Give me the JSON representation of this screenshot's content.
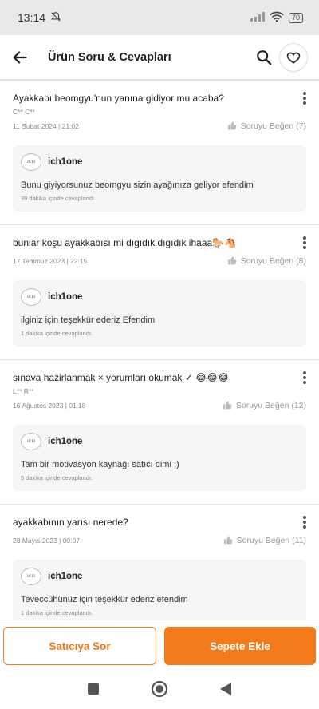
{
  "status": {
    "time": "13:14",
    "battery": "70"
  },
  "header": {
    "title": "Ürün Soru & Cevapları"
  },
  "questions": [
    {
      "text": "Ayakkabı beomgyu'nun yanına gidiyor mu acaba?",
      "author": "C** C**",
      "date": "11 Şubat 2024 | 21:02",
      "like": "Soruyu Beğen (7)",
      "seller": "ich1one",
      "answer": "Bunu giyiyorsunuz beomgyu sizin ayağınıza geliyor efendim",
      "answer_time": "39 dakika içinde cevaplandı."
    },
    {
      "text": "bunlar koşu ayakkabısı mi dıgıdık dıgıdık ihaaa🐎🐴",
      "author": "",
      "date": "17 Temmuz 2023 | 22:15",
      "like": "Soruyu Beğen (8)",
      "seller": "ich1one",
      "answer": "ilginiz için teşekkür ederiz Efendim",
      "answer_time": "1 dakika içinde cevaplandı."
    },
    {
      "text": "sınava hazirlanmak × yorumları okumak ✓  😂😂😂",
      "author": "L** R**",
      "date": "16 Ağustos 2023 | 01:18",
      "like": "Soruyu Beğen (12)",
      "seller": "ich1one",
      "answer": "Tam bir motivasyon kaynağı satıcı dimi :)",
      "answer_time": "5 dakika içinde cevaplandı."
    },
    {
      "text": "ayakkabının yarısı nerede?",
      "author": "",
      "date": "28 Mayıs 2023 | 00:07",
      "like": "Soruyu Beğen (11)",
      "seller": "ich1one",
      "answer": "Teveccühünüz için teşekkür ederiz efendim",
      "answer_time": "1 dakika içinde cevaplandı."
    }
  ],
  "buttons": {
    "ask_seller": "Satıcıya Sor",
    "add_to_cart": "Sepete Ekle"
  },
  "colors": {
    "accent": "#f27a1a"
  }
}
